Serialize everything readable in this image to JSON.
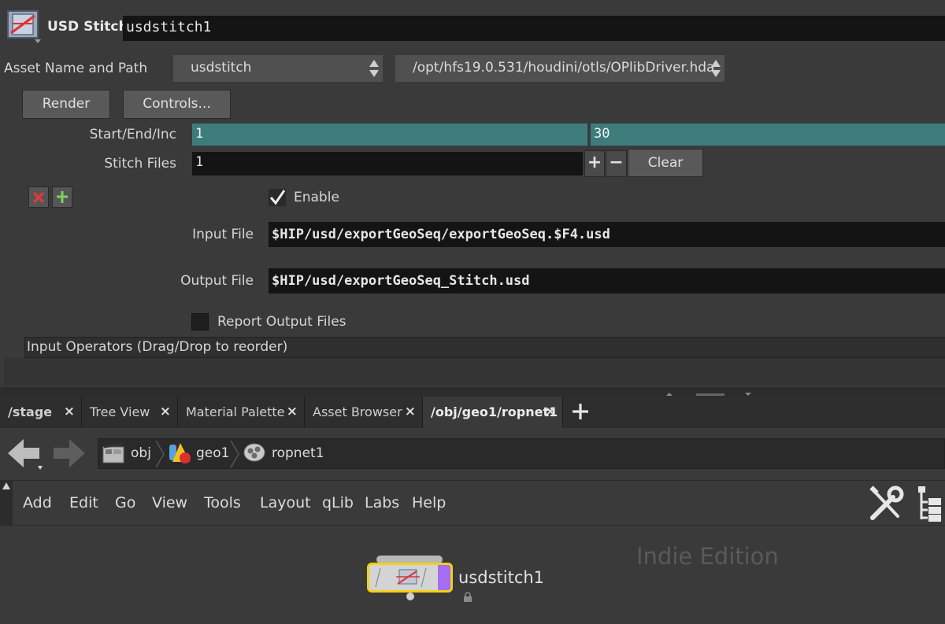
{
  "header": {
    "node_type": "USD Stitch",
    "node_name": "usdstitch1"
  },
  "asset": {
    "label": "Asset Name and Path",
    "name": "usdstitch",
    "path": "/opt/hfs19.0.531/houdini/otls/OPlibDriver.hda"
  },
  "buttons": {
    "render": "Render",
    "controls": "Controls...",
    "clear": "Clear",
    "plus": "+",
    "minus": "−"
  },
  "params": {
    "start_end_inc_label": "Start/End/Inc",
    "start": "1",
    "end": "30",
    "stitch_files_label": "Stitch Files",
    "stitch_files": "1",
    "enable_label": "Enable",
    "enable_checked": true,
    "input_file_label": "Input File",
    "input_file": "$HIP/usd/exportGeoSeq/exportGeoSeq.$F4.usd",
    "output_file_label": "Output File",
    "output_file": "$HIP/usd/exportGeoSeq_Stitch.usd",
    "report_label": "Report Output Files",
    "report_checked": false,
    "input_operators_label": "Input Operators (Drag/Drop to reorder)"
  },
  "tabs": [
    {
      "label": "/stage",
      "active": false
    },
    {
      "label": "Tree View",
      "active": false
    },
    {
      "label": "Material Palette",
      "active": false
    },
    {
      "label": "Asset Browser",
      "active": false
    },
    {
      "label": "/obj/geo1/ropnet1",
      "active": true
    }
  ],
  "breadcrumbs": [
    "obj",
    "geo1",
    "ropnet1"
  ],
  "menu": [
    "Add",
    "Edit",
    "Go",
    "View",
    "Tools",
    "Layout",
    "qLib",
    "Labs",
    "Help"
  ],
  "network": {
    "watermark": "Indie Edition",
    "node_label": "usdstitch1"
  },
  "colors": {
    "teal_field": "#3e7c7c",
    "node_outline": "#f3d11a",
    "node_flag": "#a66df0"
  }
}
